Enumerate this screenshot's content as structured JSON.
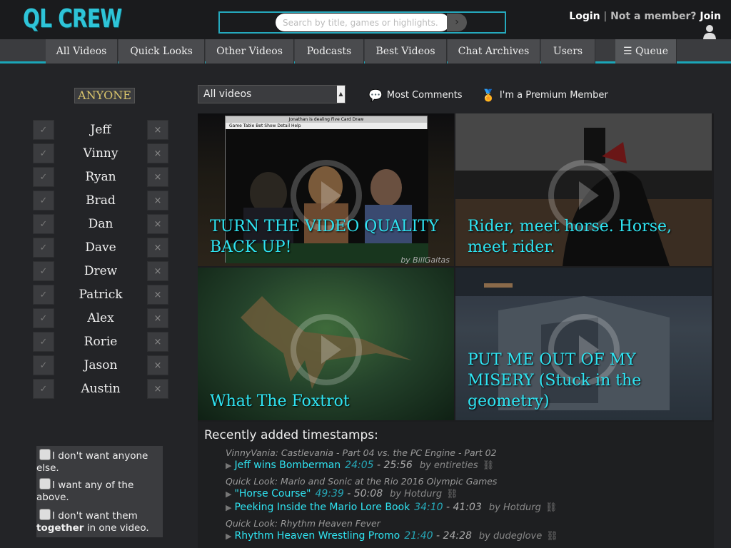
{
  "header": {
    "logo": "QL CREW",
    "search_placeholder": "Search by title, games or highlights.",
    "login": "Login",
    "separator": "|",
    "not_member": "Not a member?",
    "join": "Join"
  },
  "nav": {
    "items": [
      "All Videos",
      "Quick Looks",
      "Other Videos",
      "Podcasts",
      "Best Videos",
      "Chat Archives",
      "Users"
    ],
    "queue": "Queue"
  },
  "sidebar": {
    "anyone": "ANYONE",
    "check_glyph": "✓",
    "x_glyph": "×",
    "people": [
      "Jeff",
      "Vinny",
      "Ryan",
      "Brad",
      "Dan",
      "Dave",
      "Drew",
      "Patrick",
      "Alex",
      "Rorie",
      "Jason",
      "Austin"
    ],
    "options": {
      "opt1": "I don't want anyone else.",
      "opt2": "I want any of the above.",
      "opt3_pre": "I don't want them",
      "opt3_bold": "together",
      "opt3_post": "in one video."
    }
  },
  "filters": {
    "select_value": "All videos",
    "most_comments": "Most Comments",
    "premium": "I'm a Premium Member"
  },
  "videos": [
    {
      "title": "TURN THE VIDEO QUALITY BACK UP!",
      "credit": "by BillGaitas",
      "window_title": "Jonathan is dealing Five Card Draw",
      "window_menu": "Game  Table  Bet  Show  Detail  Help"
    },
    {
      "title": "Rider, meet horse. Horse, meet rider."
    },
    {
      "title": "What The Foxtrot"
    },
    {
      "title": "PUT ME OUT OF MY MISERY (Stuck in the geometry)"
    }
  ],
  "timestamps": {
    "heading": "Recently added timestamps:",
    "groups": [
      {
        "video": "VinnyVania: Castlevania - Part 04 vs. the PC Engine - Part 02",
        "items": [
          {
            "label": "Jeff wins Bomberman",
            "start": "24:05",
            "end": "- 25:56",
            "by": "by entireties"
          }
        ]
      },
      {
        "video": "Quick Look: Mario and Sonic at the Rio 2016 Olympic Games",
        "items": [
          {
            "label": "\"Horse Course\"",
            "start": "49:39",
            "end": "- 50:08",
            "by": "by Hotdurg"
          },
          {
            "label": "Peeking Inside the Mario Lore Book",
            "start": "34:10",
            "end": "- 41:03",
            "by": "by Hotdurg"
          }
        ]
      },
      {
        "video": "Quick Look: Rhythm Heaven Fever",
        "items": [
          {
            "label": "Rhythm Heaven Wrestling Promo",
            "start": "21:40",
            "end": "- 24:28",
            "by": "by dudeglove"
          }
        ]
      }
    ]
  },
  "colors": {
    "accent": "#2ec4d8",
    "background": "#232427",
    "title_cyan": "#2fe4f2",
    "anyone_gold": "#d8c36b"
  }
}
